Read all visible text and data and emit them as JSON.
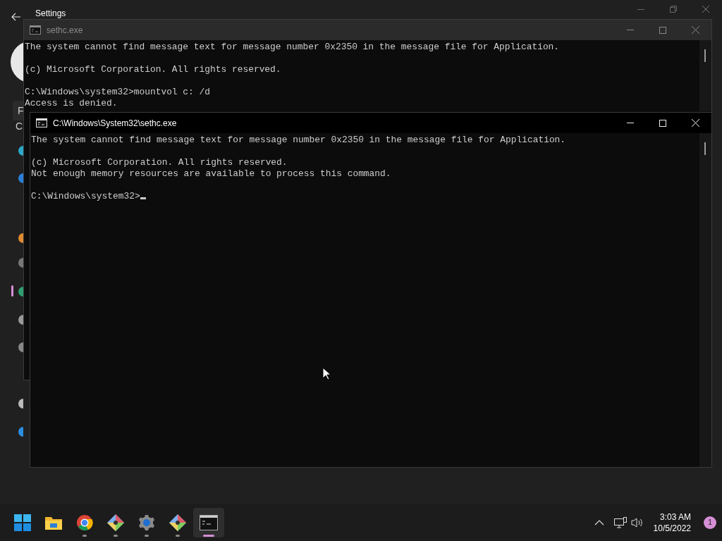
{
  "background_window": {
    "title": "Settings",
    "fragments": [
      {
        "text": "F",
        "kind": "search"
      },
      {
        "text": "C",
        "kind": "label"
      }
    ]
  },
  "windows": [
    {
      "title": "sethc.exe",
      "active": false,
      "cursor": false,
      "lines": [
        {
          "text": "The system cannot find message text for message number 0x2350 in the message file for Application.",
          "space_before": false
        },
        {
          "text": "(c) Microsoft Corporation. All rights reserved.",
          "space_before": true
        },
        {
          "text": "C:\\Windows\\system32>mountvol c: /d",
          "space_before": true
        },
        {
          "text": "Access is denied.",
          "space_before": false
        }
      ]
    },
    {
      "title": "C:\\Windows\\System32\\sethc.exe",
      "active": true,
      "cursor": true,
      "lines": [
        {
          "text": "The system cannot find message text for message number 0x2350 in the message file for Application.",
          "space_before": false
        },
        {
          "text": "(c) Microsoft Corporation. All rights reserved.",
          "space_before": true
        },
        {
          "text": "Not enough memory resources are available to process this command.",
          "space_before": false
        },
        {
          "text": "C:\\Windows\\system32>",
          "space_before": true
        }
      ]
    }
  ],
  "taskbar": {
    "apps": [
      {
        "kind": "start",
        "running": false,
        "selected": false
      },
      {
        "kind": "folder",
        "running": false,
        "selected": false
      },
      {
        "kind": "browser",
        "running": true,
        "selected": false
      },
      {
        "kind": "diamond",
        "running": true,
        "selected": false
      },
      {
        "kind": "gear",
        "running": true,
        "selected": false
      },
      {
        "kind": "diamond",
        "running": true,
        "selected": false
      },
      {
        "kind": "terminal",
        "running": true,
        "selected": true
      }
    ],
    "clock": {
      "time": "3:03 AM",
      "date": "10/5/2022"
    },
    "notification_count": "1"
  }
}
